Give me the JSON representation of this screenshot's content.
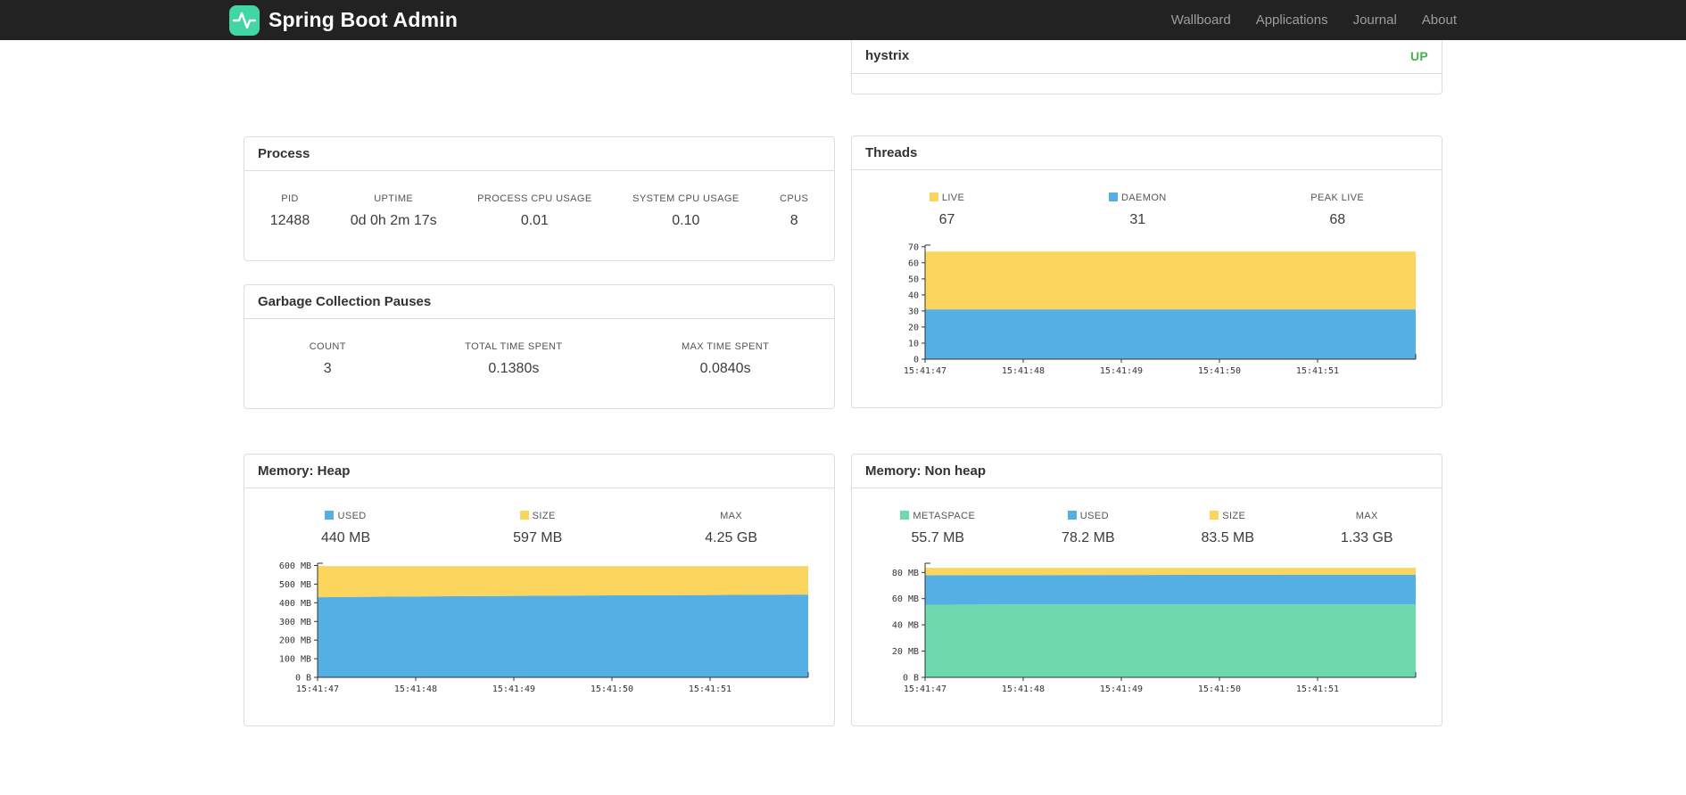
{
  "colors": {
    "yellow": "#FBD55E",
    "blue": "#54B0E4",
    "green": "#6FD9AE",
    "status_up": "#4CAF50",
    "brand_teal": "#41D6A4"
  },
  "navbar": {
    "brand": "Spring Boot Admin",
    "links": [
      {
        "label": "Wallboard"
      },
      {
        "label": "Applications"
      },
      {
        "label": "Journal"
      },
      {
        "label": "About"
      }
    ]
  },
  "applications": {
    "rows": [
      {
        "name": "hystrix",
        "status": "UP"
      }
    ]
  },
  "process": {
    "title": "Process",
    "stats": [
      {
        "label": "PID",
        "value": "12488"
      },
      {
        "label": "UPTIME",
        "value": "0d 0h 2m 17s"
      },
      {
        "label": "PROCESS CPU USAGE",
        "value": "0.01"
      },
      {
        "label": "SYSTEM CPU USAGE",
        "value": "0.10"
      },
      {
        "label": "CPUS",
        "value": "8"
      }
    ]
  },
  "gc": {
    "title": "Garbage Collection Pauses",
    "stats": [
      {
        "label": "COUNT",
        "value": "3"
      },
      {
        "label": "TOTAL TIME SPENT",
        "value": "0.1380s"
      },
      {
        "label": "MAX TIME SPENT",
        "value": "0.0840s"
      }
    ]
  },
  "threads": {
    "title": "Threads",
    "legend": [
      {
        "label": "LIVE",
        "value": "67",
        "color": "yellow"
      },
      {
        "label": "DAEMON",
        "value": "31",
        "color": "blue"
      },
      {
        "label": "PEAK LIVE",
        "value": "68"
      }
    ]
  },
  "heap": {
    "title": "Memory: Heap",
    "legend": [
      {
        "label": "USED",
        "value": "440 MB",
        "color": "blue"
      },
      {
        "label": "SIZE",
        "value": "597 MB",
        "color": "yellow"
      },
      {
        "label": "MAX",
        "value": "4.25 GB"
      }
    ]
  },
  "nonheap": {
    "title": "Memory: Non heap",
    "legend": [
      {
        "label": "METASPACE",
        "value": "55.7 MB",
        "color": "green"
      },
      {
        "label": "USED",
        "value": "78.2 MB",
        "color": "blue"
      },
      {
        "label": "SIZE",
        "value": "83.5 MB",
        "color": "yellow"
      },
      {
        "label": "MAX",
        "value": "1.33 GB"
      }
    ]
  },
  "chart_data": [
    {
      "id": "threads",
      "type": "area",
      "stacked": true,
      "x": [
        "15:41:47",
        "15:41:48",
        "15:41:49",
        "15:41:50",
        "15:41:51"
      ],
      "ymax": 71,
      "y_ticks": [
        {
          "v": 0,
          "label": "0"
        },
        {
          "v": 10,
          "label": "10"
        },
        {
          "v": 20,
          "label": "20"
        },
        {
          "v": 30,
          "label": "30"
        },
        {
          "v": 40,
          "label": "40"
        },
        {
          "v": 50,
          "label": "50"
        },
        {
          "v": 60,
          "label": "60"
        },
        {
          "v": 70,
          "label": "70"
        }
      ],
      "series": [
        {
          "name": "DAEMON",
          "color": "blue",
          "values": [
            31,
            31,
            31,
            31,
            31,
            31
          ]
        },
        {
          "name": "LIVE",
          "color": "yellow",
          "values": [
            67,
            67,
            67,
            67,
            67,
            67
          ]
        }
      ]
    },
    {
      "id": "heap",
      "type": "area",
      "stacked": true,
      "x": [
        "15:41:47",
        "15:41:48",
        "15:41:49",
        "15:41:50",
        "15:41:51"
      ],
      "ymax": 612,
      "y_ticks": [
        {
          "v": 0,
          "label": "0 B"
        },
        {
          "v": 100,
          "label": "100 MB"
        },
        {
          "v": 200,
          "label": "200 MB"
        },
        {
          "v": 300,
          "label": "300 MB"
        },
        {
          "v": 400,
          "label": "400 MB"
        },
        {
          "v": 500,
          "label": "500 MB"
        },
        {
          "v": 600,
          "label": "600 MB"
        }
      ],
      "series": [
        {
          "name": "USED",
          "color": "blue",
          "values": [
            430,
            434,
            437,
            440,
            442,
            444
          ]
        },
        {
          "name": "SIZE",
          "color": "yellow",
          "values": [
            597,
            597,
            597,
            597,
            597,
            597
          ]
        }
      ]
    },
    {
      "id": "nonheap",
      "type": "area",
      "stacked": true,
      "x": [
        "15:41:47",
        "15:41:48",
        "15:41:49",
        "15:41:50",
        "15:41:51"
      ],
      "ymax": 87,
      "y_ticks": [
        {
          "v": 0,
          "label": "0 B"
        },
        {
          "v": 20,
          "label": "20 MB"
        },
        {
          "v": 40,
          "label": "40 MB"
        },
        {
          "v": 60,
          "label": "60 MB"
        },
        {
          "v": 80,
          "label": "80 MB"
        }
      ],
      "series": [
        {
          "name": "METASPACE",
          "color": "green",
          "values": [
            55.4,
            55.5,
            55.6,
            55.7,
            55.7,
            55.7
          ]
        },
        {
          "name": "USED",
          "color": "blue",
          "values": [
            77.9,
            78.0,
            78.1,
            78.2,
            78.3,
            78.3
          ]
        },
        {
          "name": "SIZE",
          "color": "yellow",
          "values": [
            83.5,
            83.5,
            83.5,
            83.5,
            83.5,
            83.5
          ]
        }
      ]
    }
  ]
}
